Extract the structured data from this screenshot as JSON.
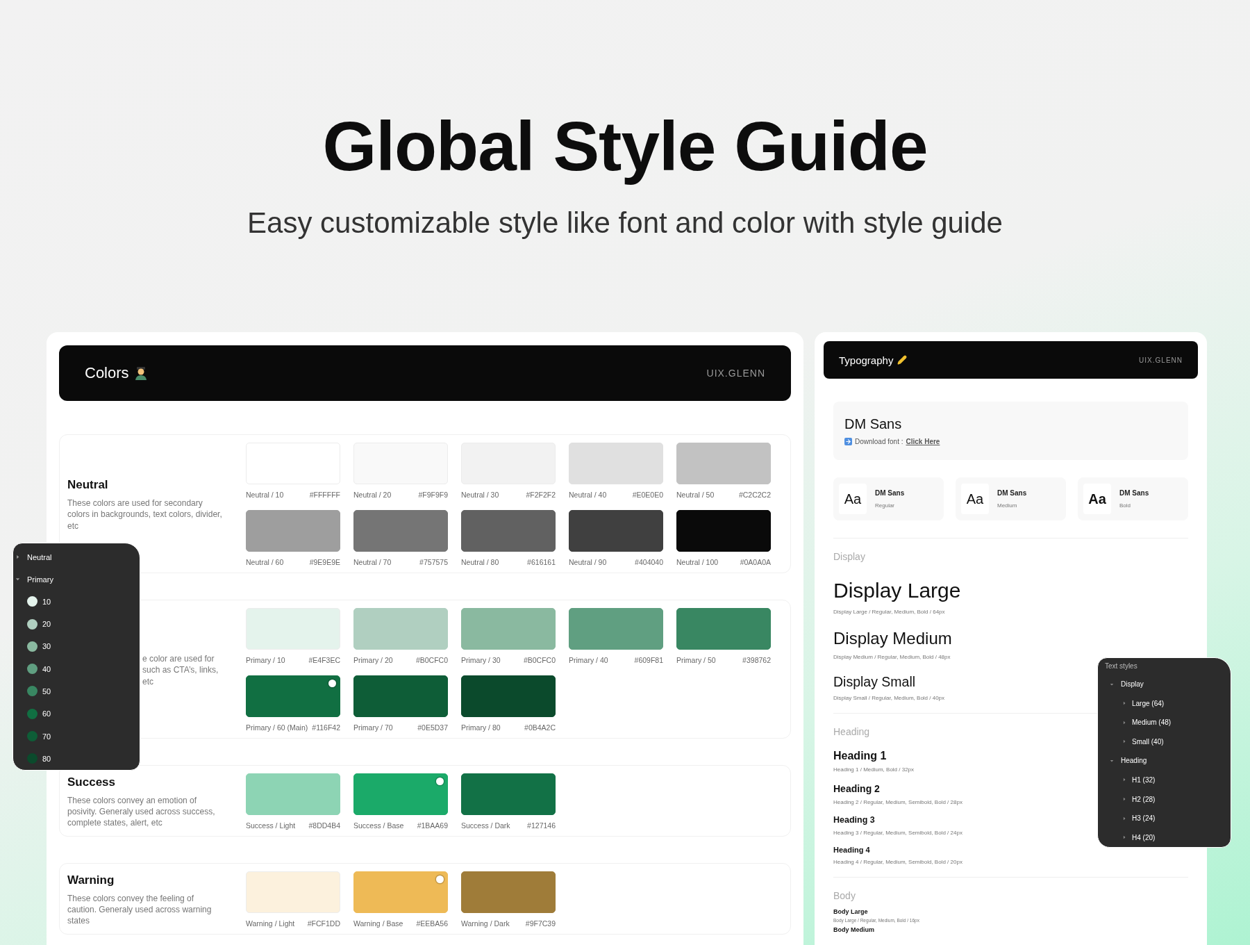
{
  "hero": {
    "title": "Global Style Guide",
    "subtitle": "Easy customizable style like font and color with style guide"
  },
  "colors_panel": {
    "title": "Colors",
    "author": "UIX.GLENN",
    "groups": [
      {
        "name": "Neutral",
        "description": "These colors are used for secondary colors in backgrounds, text colors, divider, etc",
        "swatches": [
          {
            "label": "Neutral / 10",
            "hex": "#FFFFFF",
            "color": "#ffffff",
            "selected": false
          },
          {
            "label": "Neutral / 20",
            "hex": "#F9F9F9",
            "color": "#f9f9f9",
            "selected": false
          },
          {
            "label": "Neutral / 30",
            "hex": "#F2F2F2",
            "color": "#f2f2f2",
            "selected": false
          },
          {
            "label": "Neutral / 40",
            "hex": "#E0E0E0",
            "color": "#e0e0e0",
            "selected": false
          },
          {
            "label": "Neutral / 50",
            "hex": "#C2C2C2",
            "color": "#c2c2c2",
            "selected": false
          },
          {
            "label": "Neutral / 60",
            "hex": "#9E9E9E",
            "color": "#9e9e9e",
            "selected": false
          },
          {
            "label": "Neutral / 70",
            "hex": "#757575",
            "color": "#757575",
            "selected": false
          },
          {
            "label": "Neutral / 80",
            "hex": "#616161",
            "color": "#616161",
            "selected": false
          },
          {
            "label": "Neutral / 90",
            "hex": "#404040",
            "color": "#404040",
            "selected": false
          },
          {
            "label": "Neutral / 100",
            "hex": "#0A0A0A",
            "color": "#0a0a0a",
            "selected": false
          }
        ]
      },
      {
        "description": "e color are used for\nsuch as CTA’s, links,\netc",
        "swatches": [
          {
            "label": "Primary / 10",
            "hex": "#E4F3EC",
            "color": "#e4f3ec",
            "selected": false
          },
          {
            "label": "Primary / 20",
            "hex": "#B0CFC0",
            "color": "#b0cfc0",
            "selected": false
          },
          {
            "label": "Primary / 30",
            "hex": "#B0CFC0",
            "color": "#8ab9a0",
            "selected": false
          },
          {
            "label": "Primary / 40",
            "hex": "#609F81",
            "color": "#609f81",
            "selected": false
          },
          {
            "label": "Primary / 50",
            "hex": "#398762",
            "color": "#398762",
            "selected": false
          },
          {
            "label": "Primary / 60 (Main)",
            "hex": "#116F42",
            "color": "#116f42",
            "selected": true
          },
          {
            "label": "Primary / 70",
            "hex": "#0E5D37",
            "color": "#0e5d37",
            "selected": false
          },
          {
            "label": "Primary / 80",
            "hex": "#0B4A2C",
            "color": "#0b4a2c",
            "selected": false
          }
        ]
      },
      {
        "name": "Success",
        "description": "These colors convey an emotion of posivity. Generaly used across success, complete states, alert, etc",
        "swatches": [
          {
            "label": "Success / Light",
            "hex": "#8DD4B4",
            "color": "#8dd4b4",
            "selected": false
          },
          {
            "label": "Success / Base",
            "hex": "#1BAA69",
            "color": "#1baa69",
            "selected": true
          },
          {
            "label": "Success / Dark",
            "hex": "#127146",
            "color": "#127146",
            "selected": false
          }
        ]
      },
      {
        "name": "Warning",
        "description": "These colors convey the feeling of caution. Generaly used across warning states",
        "swatches": [
          {
            "label": "Warning / Light",
            "hex": "#FCF1DD",
            "color": "#fcf1dd",
            "selected": false
          },
          {
            "label": "Warning / Base",
            "hex": "#EEBA56",
            "color": "#eeba56",
            "selected": true
          },
          {
            "label": "Warning / Dark",
            "hex": "#9F7C39",
            "color": "#9f7c39",
            "selected": false
          }
        ]
      }
    ]
  },
  "color_layers": {
    "items": [
      {
        "label": "Neutral",
        "expanded": false
      },
      {
        "label": "Primary",
        "expanded": true,
        "children": [
          {
            "label": "10",
            "color": "#e4f3ec"
          },
          {
            "label": "20",
            "color": "#b0cfc0"
          },
          {
            "label": "30",
            "color": "#8ab9a0"
          },
          {
            "label": "40",
            "color": "#609f81"
          },
          {
            "label": "50",
            "color": "#398762"
          },
          {
            "label": "60",
            "color": "#116f42"
          },
          {
            "label": "70",
            "color": "#0e5d37"
          },
          {
            "label": "80",
            "color": "#0b4a2c"
          }
        ]
      }
    ]
  },
  "typography_panel": {
    "title": "Typography",
    "author": "UIX.GLENN",
    "font": {
      "name": "DM Sans",
      "download_label": "Download font :",
      "link": "Click Here"
    },
    "weights": [
      {
        "kind": "regular",
        "sample": "Aa",
        "name": "DM Sans",
        "weight": "Regular"
      },
      {
        "kind": "medium",
        "sample": "Aa",
        "name": "DM Sans",
        "weight": "Medium"
      },
      {
        "kind": "bold",
        "sample": "Aa",
        "name": "DM Sans",
        "weight": "Bold"
      }
    ],
    "sections": [
      {
        "label": "Display",
        "styles": [
          {
            "kind": "display-large",
            "name": "Display Large",
            "spec": "Display Large / Regular, Medium, Bold / 64px"
          },
          {
            "kind": "display-medium",
            "name": "Display Medium",
            "spec": "Display Medium / Regular, Medium, Bold / 48px"
          },
          {
            "kind": "display-small",
            "name": "Display Small",
            "spec": "Display Small / Regular, Medium, Bold / 40px"
          }
        ]
      },
      {
        "label": "Heading",
        "styles": [
          {
            "kind": "heading-1",
            "name": "Heading 1",
            "spec": "Heading 1 / Medium, Bold / 32px"
          },
          {
            "kind": "heading-2",
            "name": "Heading 2",
            "spec": "Heading 2 / Regular, Medium, Semibold, Bold / 28px"
          },
          {
            "kind": "heading-3",
            "name": "Heading 3",
            "spec": "Heading 3 / Regular, Medium, Semibold, Bold / 24px"
          },
          {
            "kind": "heading-4",
            "name": "Heading 4",
            "spec": "Heading 4 / Regular, Medium, Semibold, Bold / 20px"
          }
        ]
      },
      {
        "label": "Body",
        "styles": [
          {
            "kind": "body-large",
            "name": "Body Large",
            "spec": "Body Large / Regular, Medium, Bold / 16px"
          },
          {
            "kind": "body-medium",
            "name": "Body Medium"
          }
        ]
      }
    ]
  },
  "text_styles": {
    "title": "Text styles",
    "items": [
      {
        "label": "Display",
        "expanded": true,
        "children": [
          {
            "label": "Large (64)",
            "expanded": false
          },
          {
            "label": "Medium (48)",
            "expanded": false
          },
          {
            "label": "Small (40)",
            "expanded": false
          }
        ]
      },
      {
        "label": "Heading",
        "expanded": true,
        "children": [
          {
            "label": "H1 (32)",
            "expanded": false
          },
          {
            "label": "H2 (28)",
            "expanded": false
          },
          {
            "label": "H3 (24)",
            "expanded": false
          },
          {
            "label": "H4 (20)",
            "expanded": false
          }
        ]
      }
    ]
  }
}
